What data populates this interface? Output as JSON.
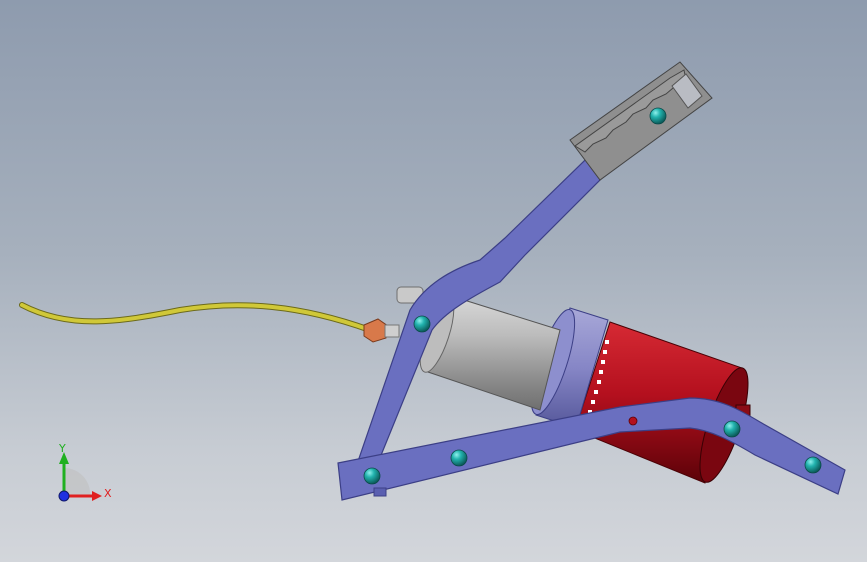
{
  "viewport": {
    "background_top": "#8e9bae",
    "background_bottom": "#d3d6db"
  },
  "model": {
    "parts": [
      "hose",
      "hose-nut",
      "lever-arm",
      "pedal-grip",
      "base-bar",
      "pump-cylinder",
      "pump-collar",
      "pump-body",
      "pivot-pins"
    ],
    "colors": {
      "lever": "#6a6fc0",
      "lever_edge": "#3c3f86",
      "hose": "#c8c030",
      "cylinder": "#a6a6a6",
      "pump_body": "#b4101e",
      "collar": "#8a8ac8",
      "pin": "#1aa3a0",
      "grip": "#8f8f8f",
      "nut": "#d8794a"
    }
  },
  "triad": {
    "x_label": "X",
    "y_label": "Y",
    "x_color": "#e02020",
    "y_color": "#20b020",
    "z_color": "#2030e0"
  }
}
